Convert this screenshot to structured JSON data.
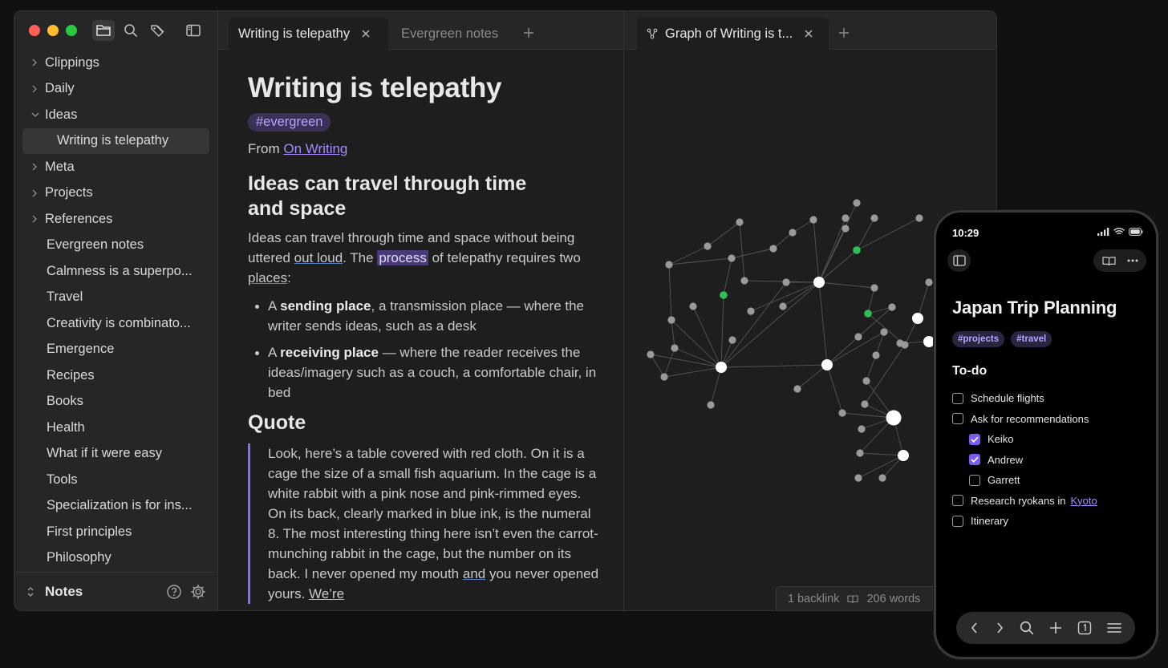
{
  "sidebar": {
    "tree": [
      {
        "label": "Clippings",
        "type": "folder",
        "expanded": false
      },
      {
        "label": "Daily",
        "type": "folder",
        "expanded": false
      },
      {
        "label": "Ideas",
        "type": "folder",
        "expanded": true
      },
      {
        "label": "Writing is telepathy",
        "type": "child",
        "selected": true
      },
      {
        "label": "Meta",
        "type": "folder",
        "expanded": false
      },
      {
        "label": "Projects",
        "type": "folder",
        "expanded": false
      },
      {
        "label": "References",
        "type": "folder",
        "expanded": false
      },
      {
        "label": "Evergreen notes",
        "type": "file"
      },
      {
        "label": "Calmness is a superpo...",
        "type": "file"
      },
      {
        "label": "Travel",
        "type": "file"
      },
      {
        "label": "Creativity is combinato...",
        "type": "file"
      },
      {
        "label": "Emergence",
        "type": "file"
      },
      {
        "label": "Recipes",
        "type": "file"
      },
      {
        "label": "Books",
        "type": "file"
      },
      {
        "label": "Health",
        "type": "file"
      },
      {
        "label": "What if it were easy",
        "type": "file"
      },
      {
        "label": "Tools",
        "type": "file"
      },
      {
        "label": "Specialization is for ins...",
        "type": "file"
      },
      {
        "label": "First principles",
        "type": "file"
      },
      {
        "label": "Philosophy",
        "type": "file"
      }
    ],
    "vault_name": "Notes"
  },
  "tabs_left": [
    {
      "label": "Writing is telepathy",
      "active": true
    },
    {
      "label": "Evergreen notes",
      "active": false
    }
  ],
  "tabs_right": [
    {
      "label": "Graph of Writing is t...",
      "active": true
    }
  ],
  "note": {
    "title": "Writing is telepathy",
    "tag": "#evergreen",
    "from_prefix": "From ",
    "from_link": "On Writing",
    "h2_ideas": "Ideas can travel through time and space",
    "para": {
      "p1": "Ideas can travel through time and space without being uttered ",
      "out_loud": "out loud",
      "p2": ". The ",
      "process": "process",
      "p3": " of telepathy requires two ",
      "places": "places",
      "p4": ":"
    },
    "bullet1": {
      "pre": "A ",
      "bold": "sending place",
      "post": ", a transmission place — where the writer sends ideas, such as a desk"
    },
    "bullet2": {
      "pre": "A ",
      "bold": "receiving place",
      "post": " — where the reader receives the ideas/imagery such as a couch, a comfortable chair, in bed"
    },
    "h2_quote": "Quote",
    "quote": {
      "q1": "Look, here’s a table covered with red cloth. On it is a cage the size of a small fish aquarium. In the cage is a white rabbit with a pink nose and pink-rimmed eyes. On its back, clearly marked in blue ink, is the numeral 8. The most interesting thing here isn’t even the carrot-munching rabbit in the cage, but the number on its back. I never opened my mouth ",
      "and": "and",
      "q2": " you never opened yours. ",
      "were": "We’re"
    }
  },
  "status_bar": {
    "backlinks": "1 backlink",
    "words": "206 words"
  },
  "colors": {
    "accent": "#a78bfa",
    "graph_node": "#9a9a9a",
    "graph_green": "#2fbf55",
    "graph_white": "#ffffff"
  },
  "phone": {
    "time": "10:29",
    "title": "Japan Trip Planning",
    "tags": [
      "#projects",
      "#travel"
    ],
    "todo_heading": "To-do",
    "items": [
      {
        "label": "Schedule flights",
        "checked": false,
        "indent": 0
      },
      {
        "label": "Ask for recommendations",
        "checked": false,
        "indent": 0
      },
      {
        "label": "Keiko",
        "checked": true,
        "indent": 1
      },
      {
        "label": "Andrew",
        "checked": true,
        "indent": 1
      },
      {
        "label": "Garrett",
        "checked": false,
        "indent": 1
      },
      {
        "label": "Research ryokans in",
        "checked": false,
        "indent": 0,
        "link": "Kyoto"
      },
      {
        "label": "Itinerary",
        "checked": false,
        "indent": 0
      }
    ]
  }
}
